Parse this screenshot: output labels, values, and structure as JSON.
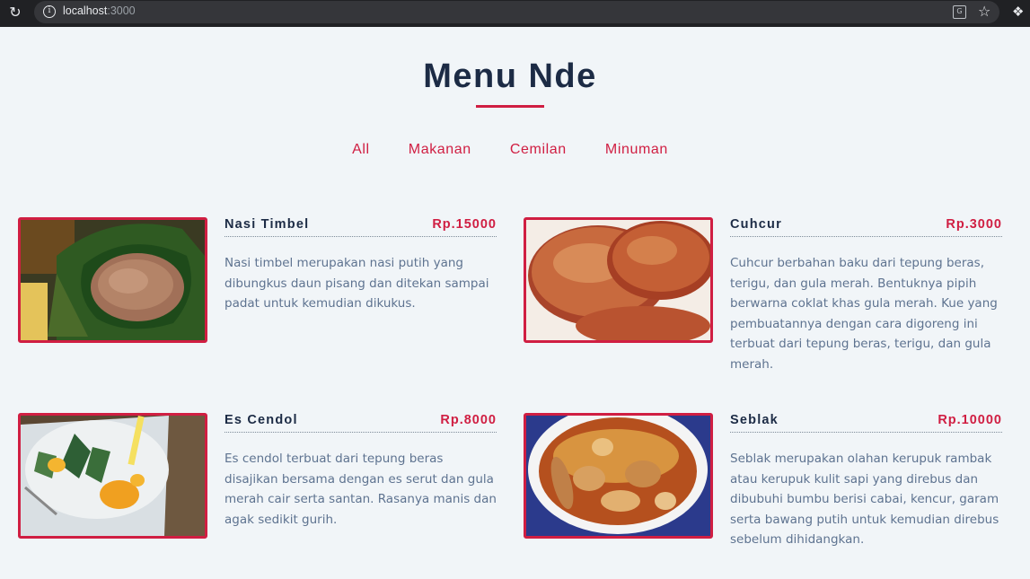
{
  "browser": {
    "url_host": "localhost",
    "url_port": ":3000"
  },
  "page": {
    "title": "Menu Nde"
  },
  "filters": [
    "All",
    "Makanan",
    "Cemilan",
    "Minuman"
  ],
  "menu": [
    {
      "name": "Nasi Timbel",
      "price": "Rp.15000",
      "description": "Nasi timbel merupakan nasi putih yang dibungkus daun pisang dan ditekan sampai padat untuk kemudian dikukus."
    },
    {
      "name": "Cuhcur",
      "price": "Rp.3000",
      "description": "Cuhcur berbahan baku dari tepung beras, terigu, dan gula merah. Bentuknya pipih berwarna coklat khas gula merah. Kue yang pembuatannya dengan cara digoreng ini terbuat dari tepung beras, terigu, dan gula merah."
    },
    {
      "name": "Es Cendol",
      "price": "Rp.8000",
      "description": "Es cendol terbuat dari tepung beras disajikan bersama dengan es serut dan gula merah cair serta santan. Rasanya manis dan agak sedikit gurih."
    },
    {
      "name": "Seblak",
      "price": "Rp.10000",
      "description": "Seblak merupakan olahan kerupuk rambak atau kerupuk kulit sapi yang direbus dan dibubuhi bumbu berisi cabai, kencur, garam serta bawang putih untuk kemudian direbus sebelum dihidangkan."
    }
  ],
  "colors": {
    "accent": "#d01e42",
    "heading": "#1c2b45",
    "text": "#5e7390",
    "background": "#f1f5f8"
  }
}
